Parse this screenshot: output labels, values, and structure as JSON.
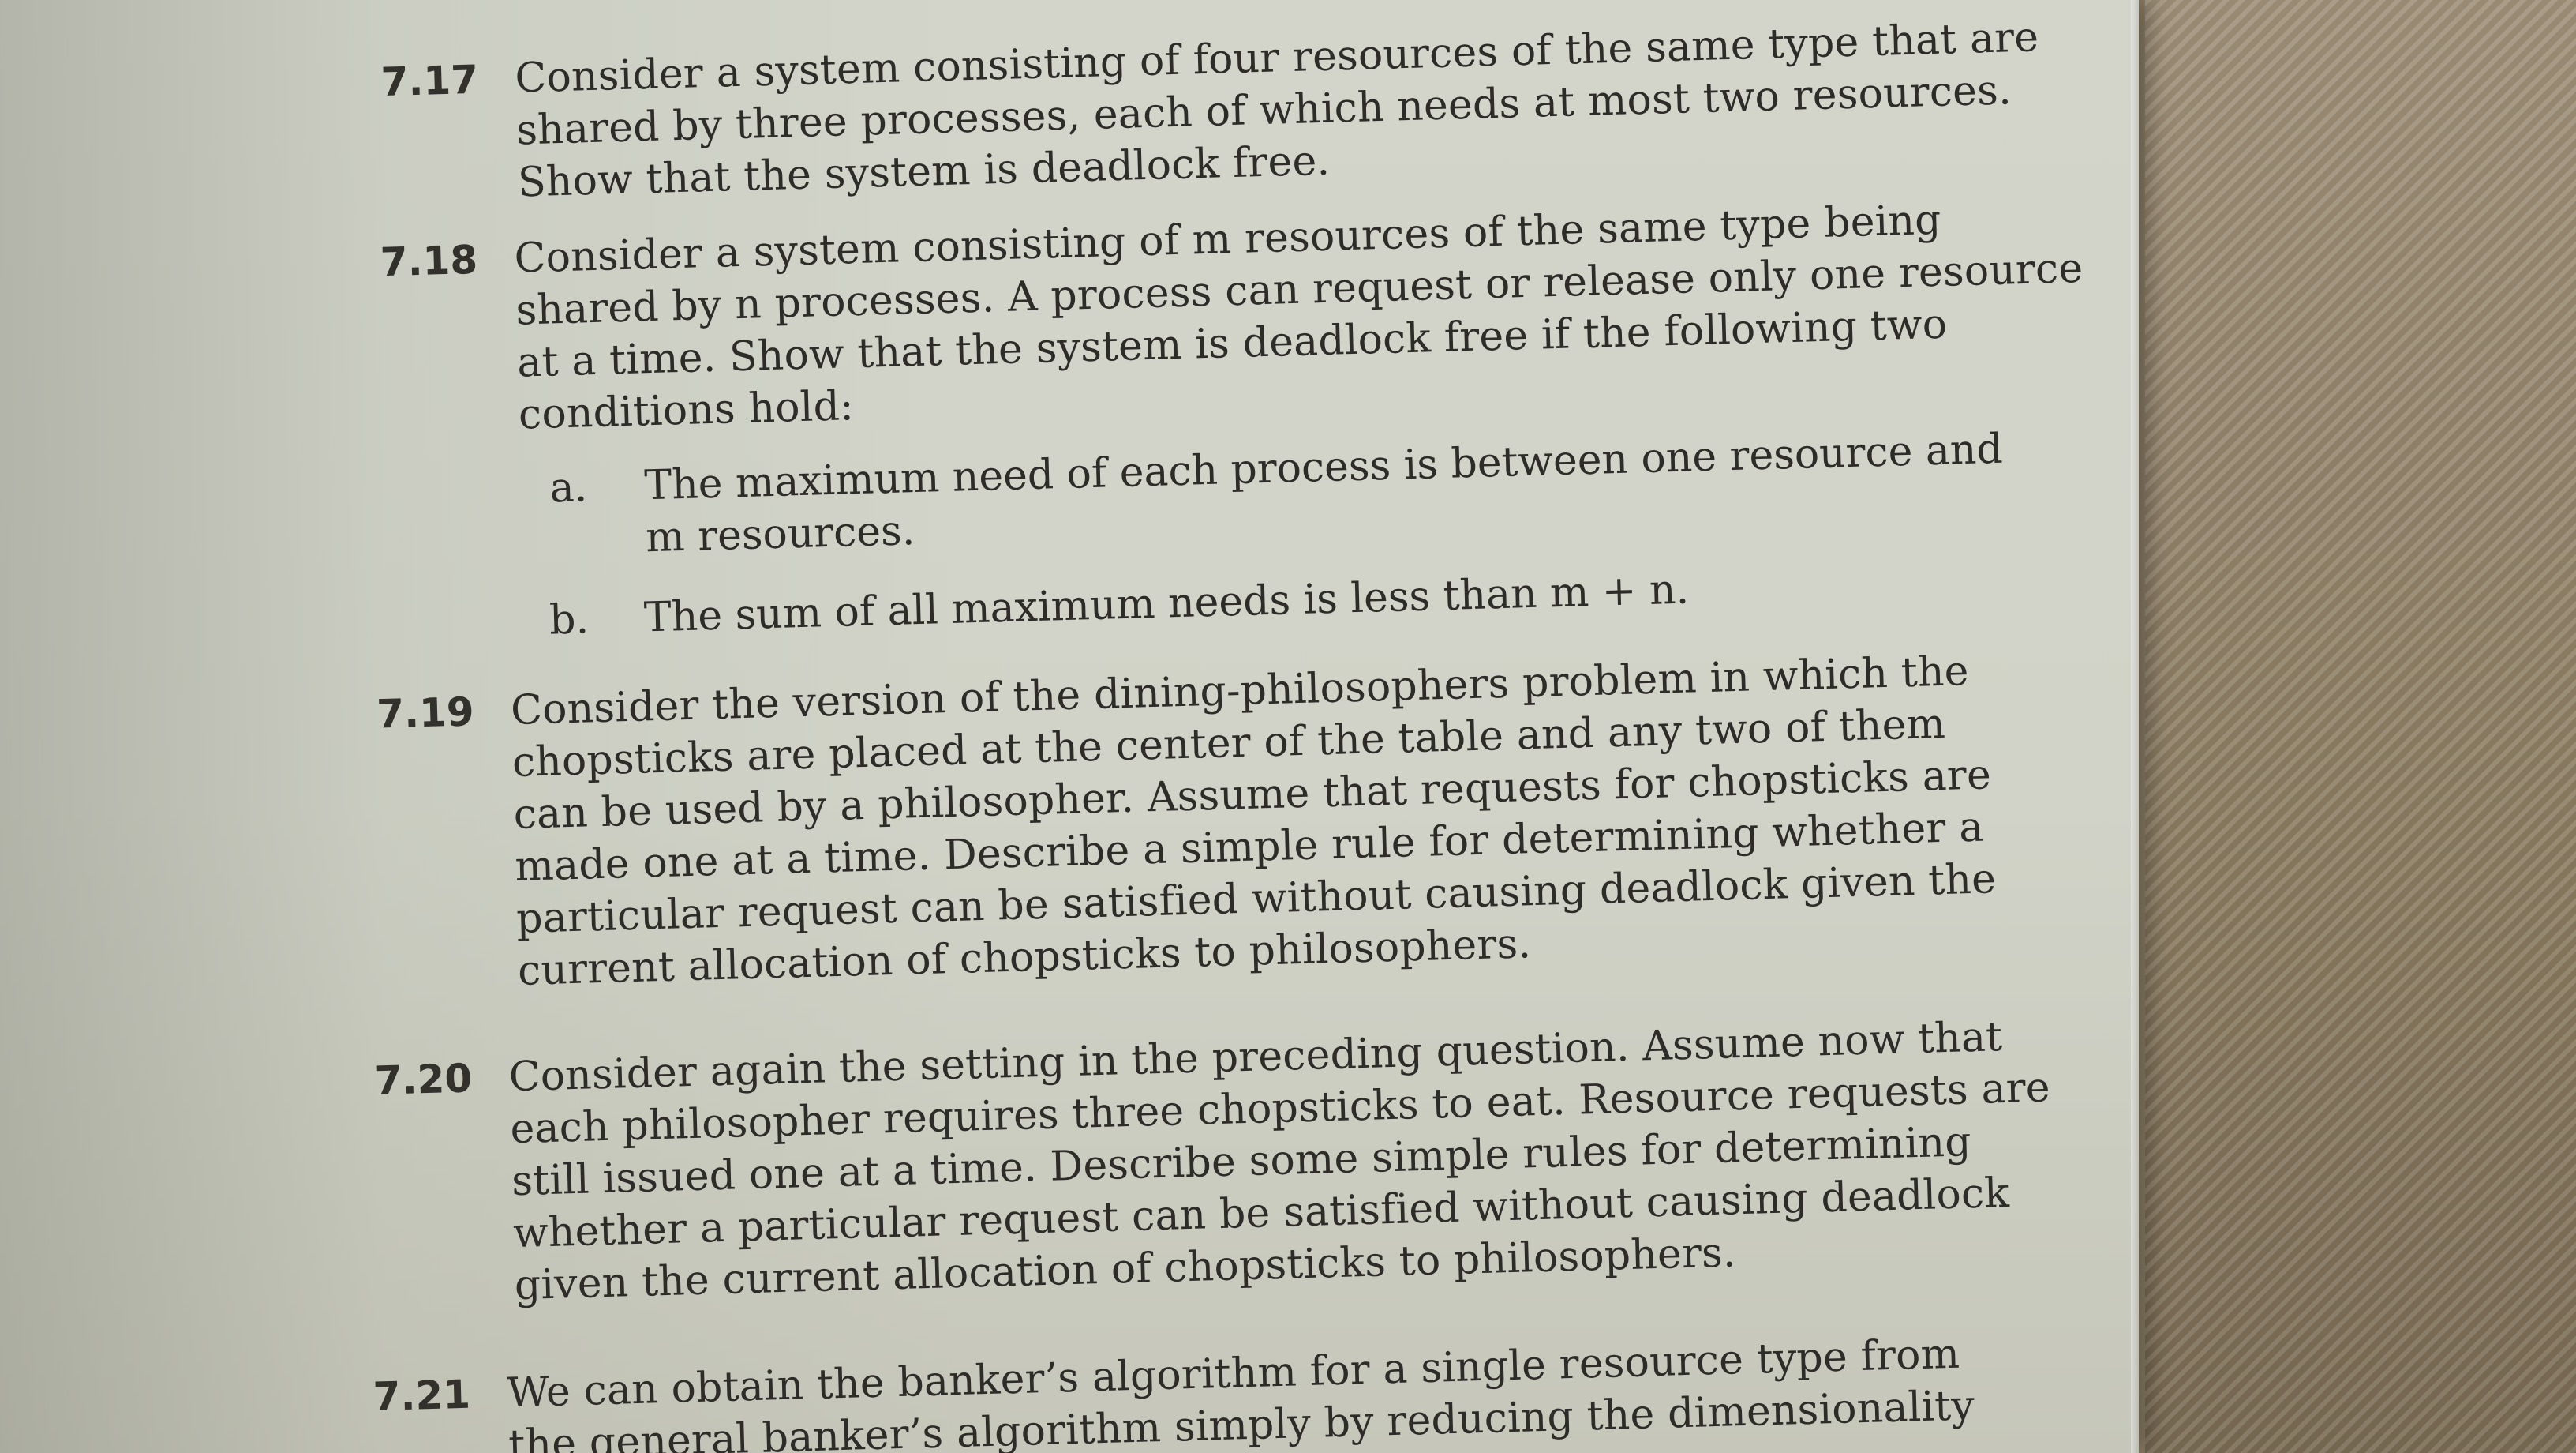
{
  "problems": [
    {
      "number": "7.17",
      "lines": [
        "Consider a system consisting of four resources of the same type that are",
        "shared by three processes, each of which needs at most two resources.",
        "Show that the system is deadlock free."
      ]
    },
    {
      "number": "7.18",
      "lines": [
        "Consider a system consisting of m resources of the same type being",
        "shared by n processes. A process can request or release only one resource",
        "at a time. Show that the system is deadlock free if the following two",
        "conditions hold:"
      ],
      "subitems": [
        {
          "letter": "a.",
          "lines": [
            "The maximum need of each process is between one resource and",
            "m resources."
          ]
        },
        {
          "letter": "b.",
          "lines": [
            "The sum of all maximum needs is less than m + n."
          ]
        }
      ]
    },
    {
      "number": "7.19",
      "lines": [
        "Consider the version of the dining-philosophers problem in which the",
        "chopsticks are placed at the center of the table and any two of them",
        "can be used by a philosopher. Assume that requests for chopsticks are",
        "made one at a time. Describe a simple rule for determining whether a",
        "particular request can be satisfied without causing deadlock given the",
        "current allocation of chopsticks to philosophers."
      ]
    },
    {
      "number": "7.20",
      "lines": [
        "Consider again the setting in the preceding question. Assume now that",
        "each philosopher requires three chopsticks to eat. Resource requests are",
        "still issued one at a time. Describe some simple rules for determining",
        "whether a particular request can be satisfied without causing deadlock",
        "given the current allocation of chopsticks to philosophers."
      ]
    },
    {
      "number": "7.21",
      "lines": [
        "We can obtain the banker’s algorithm for a single resource type from",
        "the general banker’s algorithm simply by reducing the dimensionality"
      ]
    }
  ]
}
